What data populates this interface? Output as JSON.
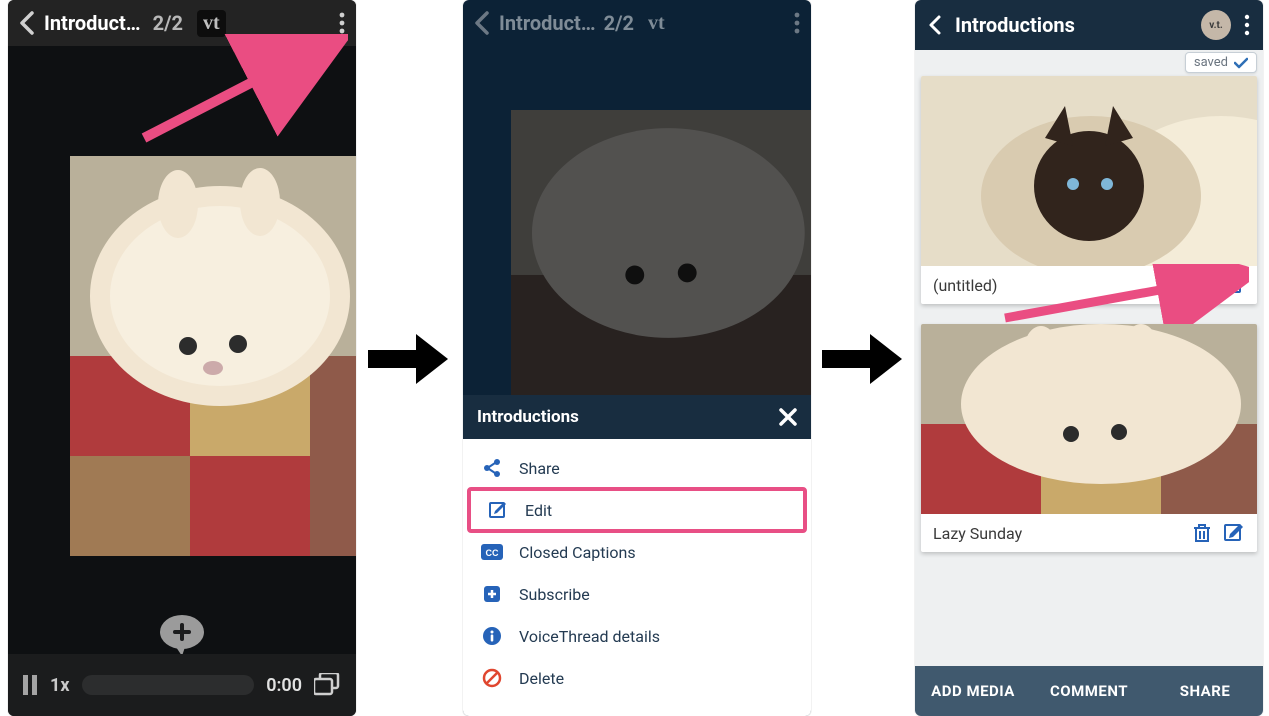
{
  "screen1": {
    "title": "Introduct…",
    "page_indicator": "2/2",
    "vt_label": "vt",
    "playback_speed": "1x",
    "timestamp": "0:00"
  },
  "screen2": {
    "title": "Introduct…",
    "page_indicator": "2/2",
    "vt_label": "vt",
    "menu_header": "Introductions",
    "menu": {
      "share": "Share",
      "edit": "Edit",
      "cc": "Closed Captions",
      "subscribe": "Subscribe",
      "details": "VoiceThread details",
      "delete": "Delete"
    }
  },
  "screen3": {
    "title": "Introductions",
    "saved_label": "saved",
    "avatar_text": "v.t.",
    "slides": [
      {
        "caption": "(untitled)"
      },
      {
        "caption": "Lazy Sunday"
      }
    ],
    "actions": {
      "add_media": "ADD MEDIA",
      "comment": "COMMENT",
      "share": "SHARE"
    }
  }
}
